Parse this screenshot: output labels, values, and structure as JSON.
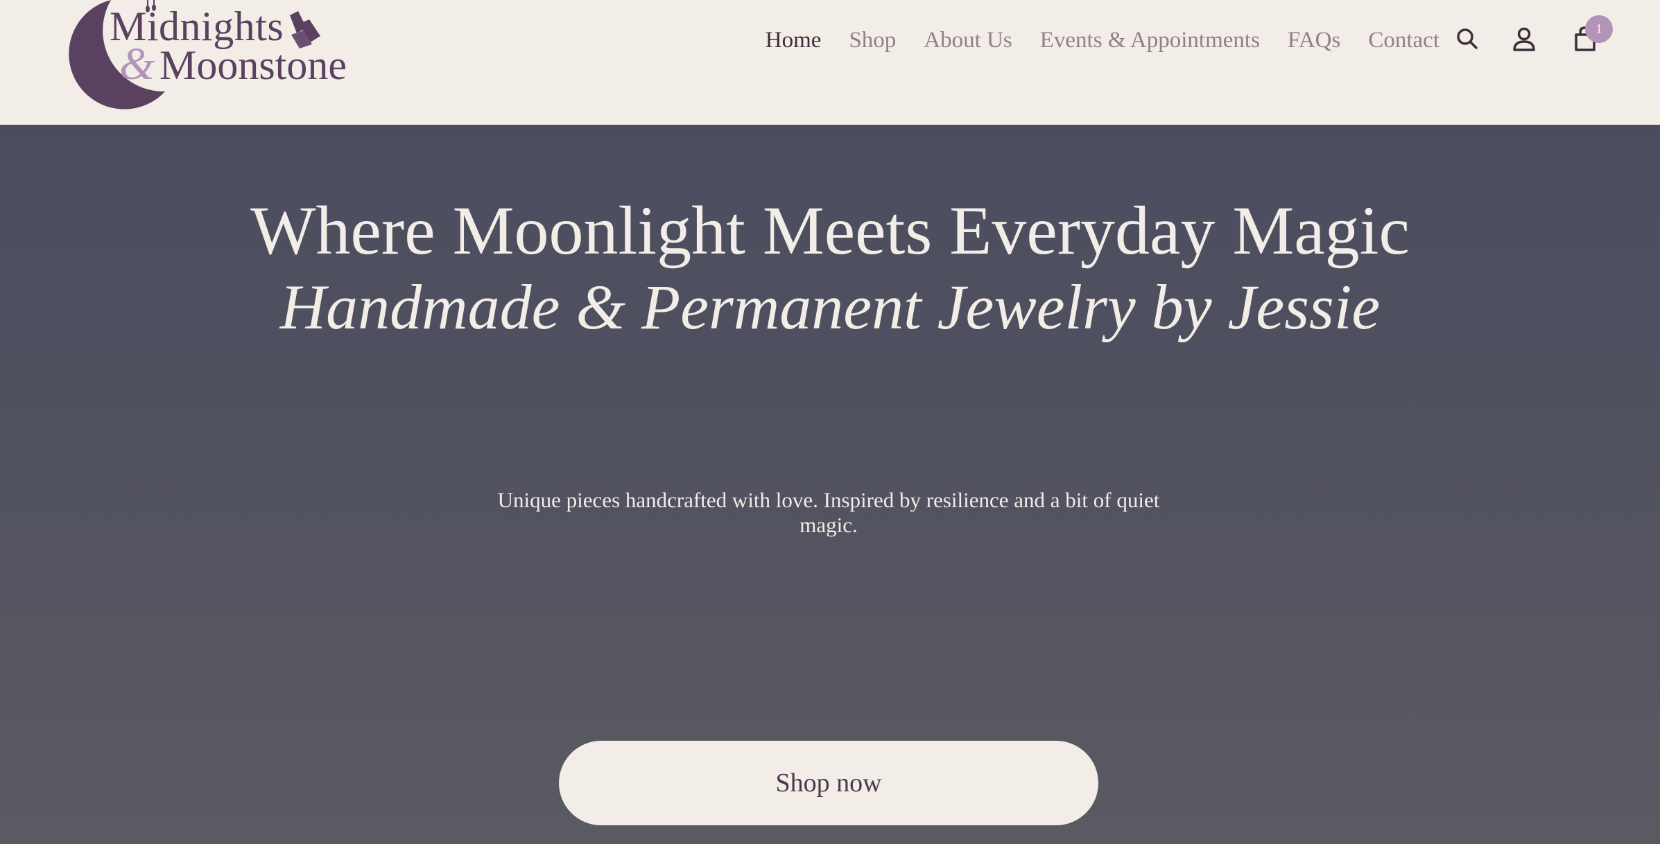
{
  "brand": {
    "name_line1": "Midnights",
    "ampersand": "&",
    "name_line2": "Moonstone",
    "logo_icon": "crescent-moon-crystal-icon"
  },
  "nav": {
    "items": [
      {
        "label": "Home",
        "active": true
      },
      {
        "label": "Shop",
        "active": false
      },
      {
        "label": "About Us",
        "active": false
      },
      {
        "label": "Events & Appointments",
        "active": false
      },
      {
        "label": "FAQs",
        "active": false
      },
      {
        "label": "Contact",
        "active": false
      }
    ],
    "icons": [
      "search-icon",
      "account-icon",
      "cart-icon"
    ],
    "cart_count": "1"
  },
  "hero": {
    "title": "Where Moonlight Meets Everyday Magic",
    "subtitle": "Handmade & Permanent Jewelry by Jessie",
    "description": "Unique pieces handcrafted with love. Inspired by resilience and a bit of quiet magic.",
    "cta_label": "Shop now"
  },
  "colors": {
    "background": "#f2ede7",
    "brand_purple": "#5b4160",
    "accent_lilac": "#b393b7",
    "hero_overlay": "#4b4d5f",
    "nav_text": "#8e8089",
    "nav_active": "#3b2f3a"
  }
}
